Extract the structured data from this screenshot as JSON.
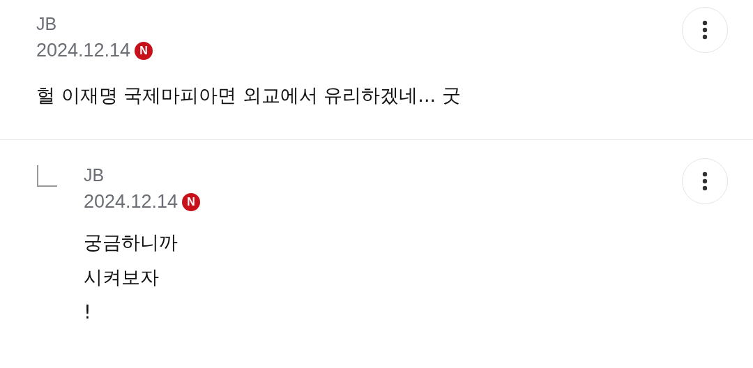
{
  "comments": [
    {
      "author": "JB",
      "date": "2024.12.14",
      "badge": "N",
      "text": "헐 이재명 국제마피아면 외교에서 유리하겠네... 굿",
      "reply": false
    },
    {
      "author": "JB",
      "date": "2024.12.14",
      "badge": "N",
      "text": "궁금하니까\n시켜보자\n!",
      "reply": true
    }
  ]
}
